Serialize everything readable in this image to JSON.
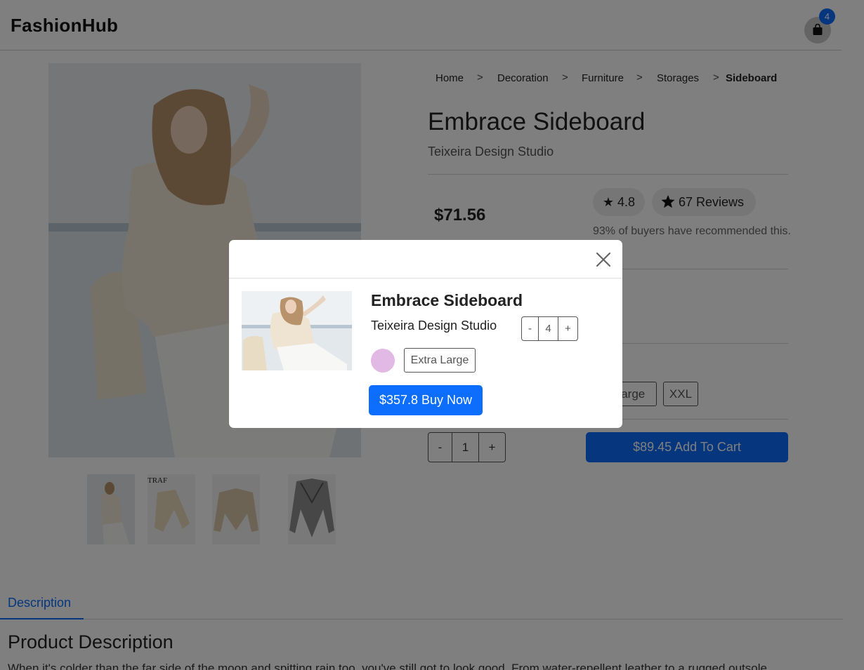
{
  "header": {
    "brand": "FashionHub",
    "cart_count": "4",
    "cart_icon": "shopping-bag-icon"
  },
  "breadcrumb": [
    {
      "label": "Home"
    },
    {
      "label": "Decoration"
    },
    {
      "label": "Furniture"
    },
    {
      "label": "Storages"
    },
    {
      "label": "Sideboard"
    }
  ],
  "breadcrumb_separator": ">",
  "product": {
    "title": "Embrace Sideboard",
    "brand": "Teixeira Design Studio",
    "price": "$71.56",
    "rating": "★ 4.8",
    "reviews": "67 Reviews",
    "recommend_text": "93% of buyers have recommended this.",
    "sizes_visible": [
      "Large",
      "XXL"
    ],
    "quantity": {
      "minus": "-",
      "value": "1",
      "plus": "+"
    },
    "add_to_cart": "$89.45 Add To Cart"
  },
  "tabs": {
    "description_tab": "Description",
    "heading": "Product Description",
    "text": "When it's colder than the far side of the moon and spitting rain too, you've still got to look good. From water-repellent leather to a rugged outsole"
  },
  "modal": {
    "title": "Embrace Sideboard",
    "brand": "Teixeira Design Studio",
    "quantity": {
      "minus": "-",
      "value": "4",
      "plus": "+"
    },
    "swatch_color": "#e2b8e4",
    "size": "Extra Large",
    "buy_now": "$357.8 Buy Now",
    "close_icon": "close-icon"
  },
  "colors": {
    "accent": "#0d6efd",
    "overlay": "rgba(0,0,0,0.5)"
  }
}
